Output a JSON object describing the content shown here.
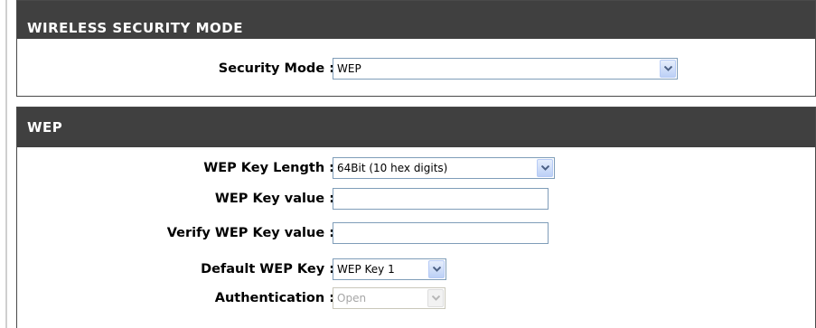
{
  "wireless_security_mode": {
    "header": "WIRELESS SECURITY MODE",
    "security_mode_label": "Security Mode :",
    "security_mode_value": "WEP"
  },
  "wep": {
    "header": "WEP",
    "key_length_label": "WEP Key Length :",
    "key_length_value": "64Bit (10 hex digits)",
    "key_value_label": "WEP Key value :",
    "key_value": "",
    "verify_key_label": "Verify WEP Key value :",
    "verify_key_value": "",
    "default_key_label": "Default WEP Key :",
    "default_key_value": "WEP Key 1",
    "authentication_label": "Authentication :",
    "authentication_value": "Open"
  },
  "colors": {
    "header_bg": "#404040",
    "header_text": "#ffffff",
    "input_border": "#7f9db9"
  }
}
